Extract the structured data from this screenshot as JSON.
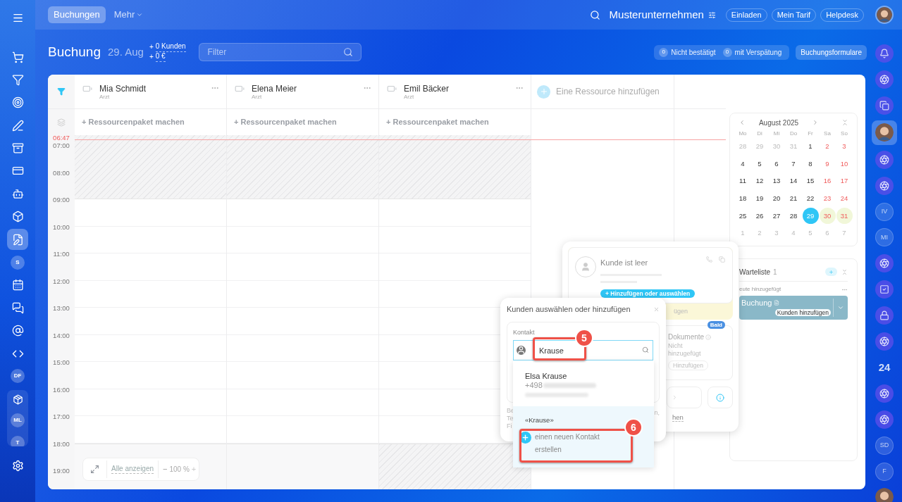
{
  "sidebar": {
    "items": [
      {
        "kind": "icon",
        "selected": false
      },
      {
        "kind": "icon",
        "selected": false
      },
      {
        "kind": "icon",
        "selected": false
      },
      {
        "kind": "icon",
        "selected": false
      },
      {
        "kind": "icon",
        "selected": false
      },
      {
        "kind": "icon",
        "selected": false
      },
      {
        "kind": "icon",
        "selected": false
      },
      {
        "kind": "icon",
        "selected": false
      },
      {
        "kind": "icon",
        "selected": false
      },
      {
        "kind": "icon",
        "selected": true
      },
      {
        "kind": "text",
        "label": "S",
        "selected": false
      },
      {
        "kind": "icon",
        "selected": false
      },
      {
        "kind": "icon",
        "selected": false
      },
      {
        "kind": "icon",
        "selected": false
      },
      {
        "kind": "icon",
        "selected": false
      },
      {
        "kind": "text",
        "label": "DF",
        "selected": false
      }
    ],
    "pinned": [
      {
        "kind": "icon"
      },
      {
        "kind": "text",
        "label": "ML"
      },
      {
        "kind": "text",
        "label": "T"
      }
    ]
  },
  "top_bar": {
    "tabs": [
      {
        "label": "Buchungen",
        "selected": true
      },
      {
        "label": "Mehr",
        "selected": false
      }
    ],
    "company": "Musterunternehmen",
    "buttons": [
      "Einladen",
      "Mein Tarif",
      "Helpdesk"
    ]
  },
  "header": {
    "title": "Buchung",
    "date": "29. Aug",
    "summary": [
      {
        "prefix": "+",
        "value": "0 Kunden"
      },
      {
        "prefix": "+",
        "value": "0 €"
      }
    ],
    "filter": {
      "placeholder": "Filter"
    },
    "counters": [
      {
        "count": "0",
        "label": "Nicht bestätigt"
      },
      {
        "count": "0",
        "label": "mit Verspätung"
      }
    ],
    "forms_button": "Buchungsformulare"
  },
  "resources": [
    {
      "name": "Mia Schmidt",
      "role": "Arzt",
      "package_action": "+ Ressourcenpaket machen",
      "evening_blocked": false
    },
    {
      "name": "Elena Meier",
      "role": "Arzt",
      "package_action": "+ Ressourcenpaket machen",
      "evening_blocked": false
    },
    {
      "name": "Emil Bäcker",
      "role": "Arzt",
      "package_action": "+ Ressourcenpaket machen",
      "evening_blocked": true
    }
  ],
  "add_resource": "Eine Ressource hinzufügen",
  "schedule": {
    "current_time": "06:47",
    "hours": [
      "07:00",
      "08:00",
      "09:00",
      "10:00",
      "11:00",
      "12:00",
      "13:00",
      "14:00",
      "15:00",
      "16:00",
      "17:00",
      "18:00",
      "19:00"
    ]
  },
  "zoom_control": {
    "show_all": "Alle anzeigen",
    "minus": "−",
    "level": "100 %",
    "plus": "+"
  },
  "calendar": {
    "month": "August 2025",
    "weekdays": [
      "Mo",
      "Di",
      "Mi",
      "Do",
      "Fr",
      "Sa",
      "So"
    ],
    "days": [
      {
        "label": "28",
        "muted": true,
        "weekend": false,
        "selected": false,
        "highlighted": false
      },
      {
        "label": "29",
        "muted": true,
        "weekend": false,
        "selected": false,
        "highlighted": false
      },
      {
        "label": "30",
        "muted": true,
        "weekend": false,
        "selected": false,
        "highlighted": false
      },
      {
        "label": "31",
        "muted": true,
        "weekend": false,
        "selected": false,
        "highlighted": false
      },
      {
        "label": "1",
        "muted": false,
        "weekend": false,
        "selected": false,
        "highlighted": false
      },
      {
        "label": "2",
        "muted": false,
        "weekend": true,
        "selected": false,
        "highlighted": false
      },
      {
        "label": "3",
        "muted": false,
        "weekend": true,
        "selected": false,
        "highlighted": false
      },
      {
        "label": "4",
        "muted": false,
        "weekend": false,
        "selected": false,
        "highlighted": false
      },
      {
        "label": "5",
        "muted": false,
        "weekend": false,
        "selected": false,
        "highlighted": false
      },
      {
        "label": "6",
        "muted": false,
        "weekend": false,
        "selected": false,
        "highlighted": false
      },
      {
        "label": "7",
        "muted": false,
        "weekend": false,
        "selected": false,
        "highlighted": false
      },
      {
        "label": "8",
        "muted": false,
        "weekend": false,
        "selected": false,
        "highlighted": false
      },
      {
        "label": "9",
        "muted": false,
        "weekend": true,
        "selected": false,
        "highlighted": false
      },
      {
        "label": "10",
        "muted": false,
        "weekend": true,
        "selected": false,
        "highlighted": false
      },
      {
        "label": "11",
        "muted": false,
        "weekend": false,
        "selected": false,
        "highlighted": false
      },
      {
        "label": "12",
        "muted": false,
        "weekend": false,
        "selected": false,
        "highlighted": false
      },
      {
        "label": "13",
        "muted": false,
        "weekend": false,
        "selected": false,
        "highlighted": false
      },
      {
        "label": "14",
        "muted": false,
        "weekend": false,
        "selected": false,
        "highlighted": false
      },
      {
        "label": "15",
        "muted": false,
        "weekend": false,
        "selected": false,
        "highlighted": false
      },
      {
        "label": "16",
        "muted": false,
        "weekend": true,
        "selected": false,
        "highlighted": false
      },
      {
        "label": "17",
        "muted": false,
        "weekend": true,
        "selected": false,
        "highlighted": false
      },
      {
        "label": "18",
        "muted": false,
        "weekend": false,
        "selected": false,
        "highlighted": false
      },
      {
        "label": "19",
        "muted": false,
        "weekend": false,
        "selected": false,
        "highlighted": false
      },
      {
        "label": "20",
        "muted": false,
        "weekend": false,
        "selected": false,
        "highlighted": false
      },
      {
        "label": "21",
        "muted": false,
        "weekend": false,
        "selected": false,
        "highlighted": false
      },
      {
        "label": "22",
        "muted": false,
        "weekend": false,
        "selected": false,
        "highlighted": false
      },
      {
        "label": "23",
        "muted": false,
        "weekend": true,
        "selected": false,
        "highlighted": false
      },
      {
        "label": "24",
        "muted": false,
        "weekend": true,
        "selected": false,
        "highlighted": false
      },
      {
        "label": "25",
        "muted": false,
        "weekend": false,
        "selected": false,
        "highlighted": false
      },
      {
        "label": "26",
        "muted": false,
        "weekend": false,
        "selected": false,
        "highlighted": false
      },
      {
        "label": "27",
        "muted": false,
        "weekend": false,
        "selected": false,
        "highlighted": false
      },
      {
        "label": "28",
        "muted": false,
        "weekend": false,
        "selected": false,
        "highlighted": false
      },
      {
        "label": "29",
        "muted": false,
        "weekend": false,
        "selected": true,
        "highlighted": false
      },
      {
        "label": "30",
        "muted": false,
        "weekend": true,
        "selected": false,
        "highlighted": true
      },
      {
        "label": "31",
        "muted": false,
        "weekend": true,
        "selected": false,
        "highlighted": true
      },
      {
        "label": "1",
        "muted": true,
        "weekend": false,
        "selected": false,
        "highlighted": false
      },
      {
        "label": "2",
        "muted": true,
        "weekend": false,
        "selected": false,
        "highlighted": false
      },
      {
        "label": "3",
        "muted": true,
        "weekend": false,
        "selected": false,
        "highlighted": false
      },
      {
        "label": "4",
        "muted": true,
        "weekend": false,
        "selected": false,
        "highlighted": false
      },
      {
        "label": "5",
        "muted": true,
        "weekend": false,
        "selected": false,
        "highlighted": false
      },
      {
        "label": "6",
        "muted": true,
        "weekend": false,
        "selected": false,
        "highlighted": false
      },
      {
        "label": "7",
        "muted": true,
        "weekend": false,
        "selected": false,
        "highlighted": false
      }
    ]
  },
  "waitlist": {
    "title": "Warteliste",
    "count": "1",
    "group": "eute hinzugefügt",
    "item": {
      "title": "Buchung",
      "action": "Kunden hinzufügen"
    }
  },
  "booking_popup": {
    "client_placeholder": "Kunde ist leer",
    "add_button": "+ Hinzufügen oder auswählen",
    "strip_text": "ügen",
    "badge": "Bald",
    "documents_title": "Dokumente",
    "documents_status": "Nicht hinzugefügt",
    "documents_button": "Hinzufügen",
    "link_fragment": "hen"
  },
  "client_dialog": {
    "title": "Kunden auswählen oder hinzufügen",
    "field_label": "Kontakt",
    "search_value": "Krause",
    "hint_lines": [
      "Be",
      "Te",
      "Fi"
    ],
    "hint_right": "n,",
    "results": [
      {
        "name": "Elsa Krause",
        "phone": "+498"
      }
    ],
    "query": "«Krause»",
    "create_action": "einen neuen Kontakt erstellen"
  },
  "annotations": [
    {
      "number": "5"
    },
    {
      "number": "6"
    }
  ],
  "right_bar": {
    "items": [
      {
        "kind": "icon",
        "selected": false
      },
      {
        "kind": "icon",
        "selected": false
      },
      {
        "kind": "icon",
        "selected": false
      },
      {
        "kind": "avatar",
        "selected": true
      },
      {
        "kind": "icon",
        "selected": false
      },
      {
        "kind": "icon",
        "selected": false
      },
      {
        "kind": "text",
        "label": "IV",
        "selected": false
      },
      {
        "kind": "text",
        "label": "MI",
        "selected": false
      },
      {
        "kind": "icon",
        "selected": false
      },
      {
        "kind": "icon",
        "selected": false
      },
      {
        "kind": "icon",
        "selected": false
      },
      {
        "kind": "icon",
        "selected": false
      },
      {
        "kind": "number",
        "label": "24",
        "selected": false
      },
      {
        "kind": "icon",
        "selected": false
      },
      {
        "kind": "icon",
        "selected": false
      },
      {
        "kind": "text",
        "label": "SD",
        "selected": false
      },
      {
        "kind": "text",
        "label": "F",
        "selected": false
      },
      {
        "kind": "avatar",
        "selected": false
      }
    ]
  }
}
